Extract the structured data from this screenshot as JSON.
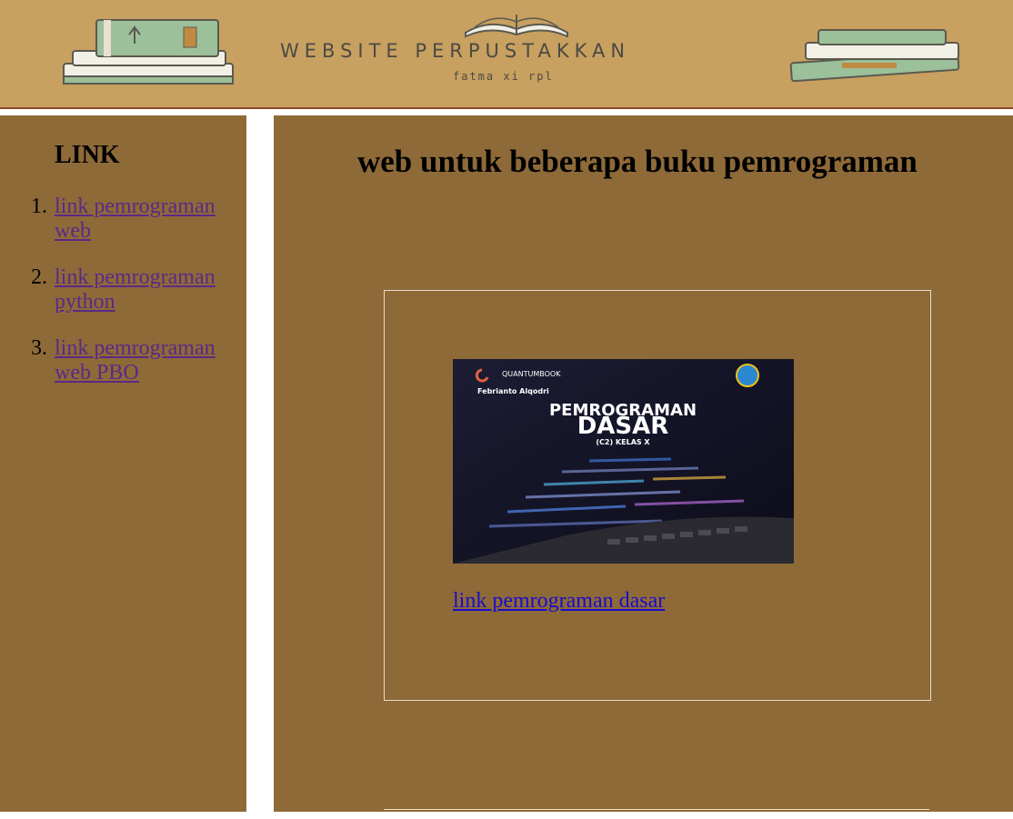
{
  "header": {
    "title": "WEBSITE PERPUSTAKKAN",
    "subtitle": "fatma xi rpl",
    "background_color": "#c8a060",
    "decorations": [
      "book-stack-left",
      "open-book",
      "book-stack-right"
    ]
  },
  "sidebar": {
    "heading": "LINK",
    "items": [
      {
        "number": "1.",
        "label": "link pemrograman web"
      },
      {
        "number": "2.",
        "label": "link pemrograman python"
      },
      {
        "number": "3.",
        "label": "link pemrograman web PBO"
      }
    ],
    "background_color": "#8e6a38",
    "link_color": "#5a2a86"
  },
  "main": {
    "title": "web untuk beberapa buku pemrograman",
    "background_color": "#8e6a38",
    "card": {
      "cover": {
        "publisher": "QUANTUMBOOK",
        "author": "Febrianto Alqodri",
        "title_line1": "PEMROGRAMAN",
        "title_line2": "DASAR",
        "subtitle": "(C2) KELAS X",
        "badge": "Tut Wuri Handayani"
      },
      "link_label": "link pemrograman dasar",
      "link_color": "#1a0ccc"
    }
  }
}
